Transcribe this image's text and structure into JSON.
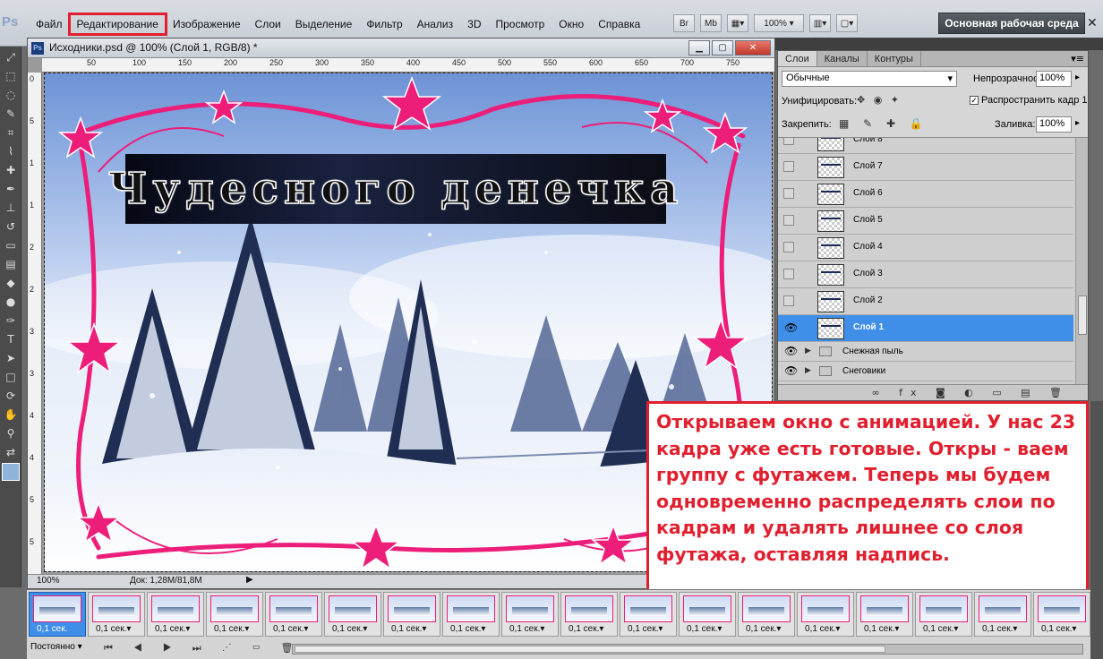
{
  "app": {
    "logo": "Ps"
  },
  "menu": [
    {
      "label": "Файл",
      "active": false
    },
    {
      "label": "Редактирование",
      "active": true
    },
    {
      "label": "Изображение",
      "active": false
    },
    {
      "label": "Слои",
      "active": false
    },
    {
      "label": "Выделение",
      "active": false
    },
    {
      "label": "Фильтр",
      "active": false
    },
    {
      "label": "Анализ",
      "active": false
    },
    {
      "label": "3D",
      "active": false
    },
    {
      "label": "Просмотр",
      "active": false
    },
    {
      "label": "Окно",
      "active": false
    },
    {
      "label": "Справка",
      "active": false
    }
  ],
  "menu_tools": {
    "bridge": "Br",
    "minibridge": "Mb",
    "zoom": "100%"
  },
  "workspace": "Основная рабочая среда",
  "document": {
    "title": "Исходники.psd @ 100% (Слой 1, RGB/8) *",
    "zoom": "100%",
    "doc_size": "Док: 1,28M/81,8M",
    "artwork_text": "Чудесного денечка",
    "ruler_top": [
      "50",
      "100",
      "150",
      "200",
      "250",
      "300",
      "350",
      "400",
      "450",
      "500",
      "550",
      "600",
      "650",
      "700",
      "750"
    ],
    "ruler_left": [
      "0",
      "5",
      "1",
      "1",
      "2",
      "2",
      "3",
      "3",
      "4",
      "4",
      "5",
      "5"
    ]
  },
  "layers_panel": {
    "tabs": [
      {
        "label": "Слои",
        "active": true
      },
      {
        "label": "Каналы",
        "active": false
      },
      {
        "label": "Контуры",
        "active": false
      }
    ],
    "blend_mode": "Обычные",
    "opacity_label": "Непрозрачность:",
    "opacity": "100%",
    "unify_label": "Унифицировать:",
    "propagate_label": "Распространить кадр 1",
    "lock_label": "Закрепить:",
    "fill_label": "Заливка:",
    "fill": "100%",
    "layers": [
      {
        "name": "Слой 8",
        "visible": false,
        "selected": false
      },
      {
        "name": "Слой 7",
        "visible": false,
        "selected": false
      },
      {
        "name": "Слой 6",
        "visible": false,
        "selected": false
      },
      {
        "name": "Слой 5",
        "visible": false,
        "selected": false
      },
      {
        "name": "Слой 4",
        "visible": false,
        "selected": false
      },
      {
        "name": "Слой 3",
        "visible": false,
        "selected": false
      },
      {
        "name": "Слой 2",
        "visible": false,
        "selected": false
      },
      {
        "name": "Слой 1",
        "visible": true,
        "selected": true
      }
    ],
    "groups": [
      {
        "name": "Снежная пыль",
        "visible": true
      },
      {
        "name": "Снеговики",
        "visible": true
      }
    ]
  },
  "annotation": "Открываем окно с анимацией. У нас 23 кадра уже есть готовые. Откры - ваем группу с футажем. Теперь мы будем одновременно распределять слои по кадрам и удалять лишнее со слоя футажа, оставляя надпись.",
  "timeline": {
    "frames": [
      {
        "delay": "0,1 сек.",
        "selected": true
      },
      {
        "delay": "0,1 сек.▾",
        "selected": false
      },
      {
        "delay": "0,1 сек.▾",
        "selected": false
      },
      {
        "delay": "0,1 сек.▾",
        "selected": false
      },
      {
        "delay": "0,1 сек.▾",
        "selected": false
      },
      {
        "delay": "0,1 сек.▾",
        "selected": false
      },
      {
        "delay": "0,1 сек.▾",
        "selected": false
      },
      {
        "delay": "0,1 сек.▾",
        "selected": false
      },
      {
        "delay": "0,1 сек.▾",
        "selected": false
      },
      {
        "delay": "0,1 сек.▾",
        "selected": false
      },
      {
        "delay": "0,1 сек.▾",
        "selected": false
      },
      {
        "delay": "0,1 сек.▾",
        "selected": false
      },
      {
        "delay": "0,1 сек.▾",
        "selected": false
      },
      {
        "delay": "0,1 сек.▾",
        "selected": false
      },
      {
        "delay": "0,1 сек.▾",
        "selected": false
      },
      {
        "delay": "0,1 сек.▾",
        "selected": false
      },
      {
        "delay": "0,1 сек.▾",
        "selected": false
      },
      {
        "delay": "0,1 сек.▾",
        "selected": false
      }
    ],
    "loop": "Постоянно ▾"
  },
  "colors": {
    "accent_red": "#e0202f",
    "selection_blue": "#3f8ee8",
    "frame_pink": "#ec1e7a"
  }
}
